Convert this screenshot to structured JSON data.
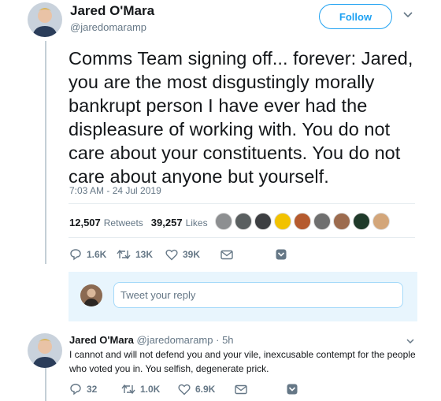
{
  "tweet": {
    "author_name": "Jared O'Mara",
    "author_handle": "@jaredomaramp",
    "follow_label": "Follow",
    "text": "Comms Team signing off... forever: Jared, you are the most disgustingly morally bankrupt person I have ever had the displeasure of working with. You do not care about your constituents. You do not care about anyone but yourself.",
    "timestamp": "7:03 AM - 24 Jul 2019",
    "retweets_count": "12,507",
    "retweets_label": "Retweets",
    "likes_count": "39,257",
    "likes_label": "Likes",
    "likers": [
      "#8d8f91",
      "#5a5f60",
      "#3d3f42",
      "#f2c200",
      "#b55a2e",
      "#6f6f6f",
      "#9c6b4e",
      "#1f3a2a",
      "#d3a67a"
    ],
    "actions": {
      "replies": "1.6K",
      "retweets": "13K",
      "likes": "39K"
    }
  },
  "compose": {
    "placeholder": "Tweet your reply"
  },
  "reply": {
    "author_name": "Jared O'Mara",
    "author_handle": "@jaredomaramp",
    "age": "· 5h",
    "text": "I cannot and will not defend you and your vile, inexcusable contempt for the people who voted you in. You selfish, degenerate prick.",
    "actions": {
      "replies": "32",
      "retweets": "1.0K",
      "likes": "6.9K"
    }
  },
  "colors": {
    "accent": "#1da1f2",
    "muted": "#657786",
    "compose_bg": "#e8f5fd"
  }
}
